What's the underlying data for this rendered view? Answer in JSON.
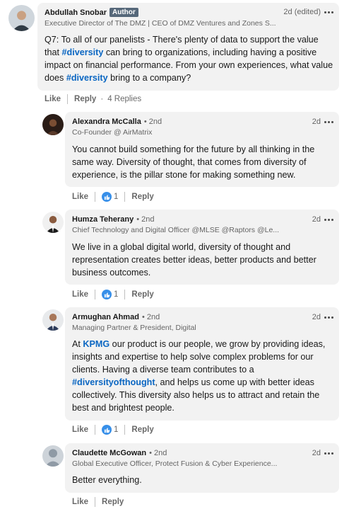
{
  "comments": [
    {
      "name": "Abdullah Snobar",
      "badge": "Author",
      "subtitle": "Executive Director of The DMZ | CEO of DMZ Ventures and Zones S...",
      "time": "2d (edited)",
      "body": [
        {
          "t": "Q7: To all of our panelists - There's plenty of data to support the value that "
        },
        {
          "t": "#diversity",
          "tag": true
        },
        {
          "t": " can bring to organizations, including having a positive impact on financial performance. From your own experiences, what value does "
        },
        {
          "t": "#diversity",
          "tag": true
        },
        {
          "t": " bring to a company?"
        }
      ],
      "like_label": "Like",
      "reply_label": "Reply",
      "replies_text": "4 Replies"
    },
    {
      "name": "Alexandra McCalla",
      "degree": "• 2nd",
      "subtitle": "Co-Founder @ AirMatrix",
      "time": "2d",
      "body": [
        {
          "t": "You cannot build something for the future by all thinking in the same way. Diversity of thought, that comes from diversity of experience, is the pillar stone for making something new."
        }
      ],
      "like_label": "Like",
      "reaction_count": "1",
      "reply_label": "Reply"
    },
    {
      "name": "Humza Teherany",
      "degree": "• 2nd",
      "subtitle": "Chief Technology and Digital Officer @MLSE @Raptors @Le...",
      "time": "2d",
      "body": [
        {
          "t": "We live in a global digital world, diversity of thought and representation creates better ideas, better products and better business outcomes."
        }
      ],
      "like_label": "Like",
      "reaction_count": "1",
      "reply_label": "Reply"
    },
    {
      "name": "Armughan Ahmad",
      "degree": "• 2nd",
      "subtitle": "Managing Partner & President, Digital",
      "time": "2d",
      "body": [
        {
          "t": "At "
        },
        {
          "t": "KPMG",
          "tag": true
        },
        {
          "t": " our product is our people, we grow by providing ideas, insights and expertise to help solve complex problems for our clients. Having a diverse team contributes to a "
        },
        {
          "t": "#diversityofthought",
          "tag": true
        },
        {
          "t": ", and helps us come up with better ideas collectively. This diversity also helps us to attract and retain the best and brightest people."
        }
      ],
      "like_label": "Like",
      "reaction_count": "1",
      "reply_label": "Reply"
    },
    {
      "name": "Claudette McGowan",
      "degree": "• 2nd",
      "subtitle": "Global Executive Officer, Protect Fusion & Cyber Experience...",
      "time": "2d",
      "body": [
        {
          "t": "Better everything."
        }
      ],
      "like_label": "Like",
      "reply_label": "Reply"
    }
  ],
  "icons": {
    "more": "more-options-icon",
    "reaction": "like-reaction-icon"
  },
  "colors": {
    "hashtag": "#0a66c2",
    "bubble": "#f2f2f2",
    "author_badge": "#56687a",
    "reaction": "#378fe9"
  }
}
